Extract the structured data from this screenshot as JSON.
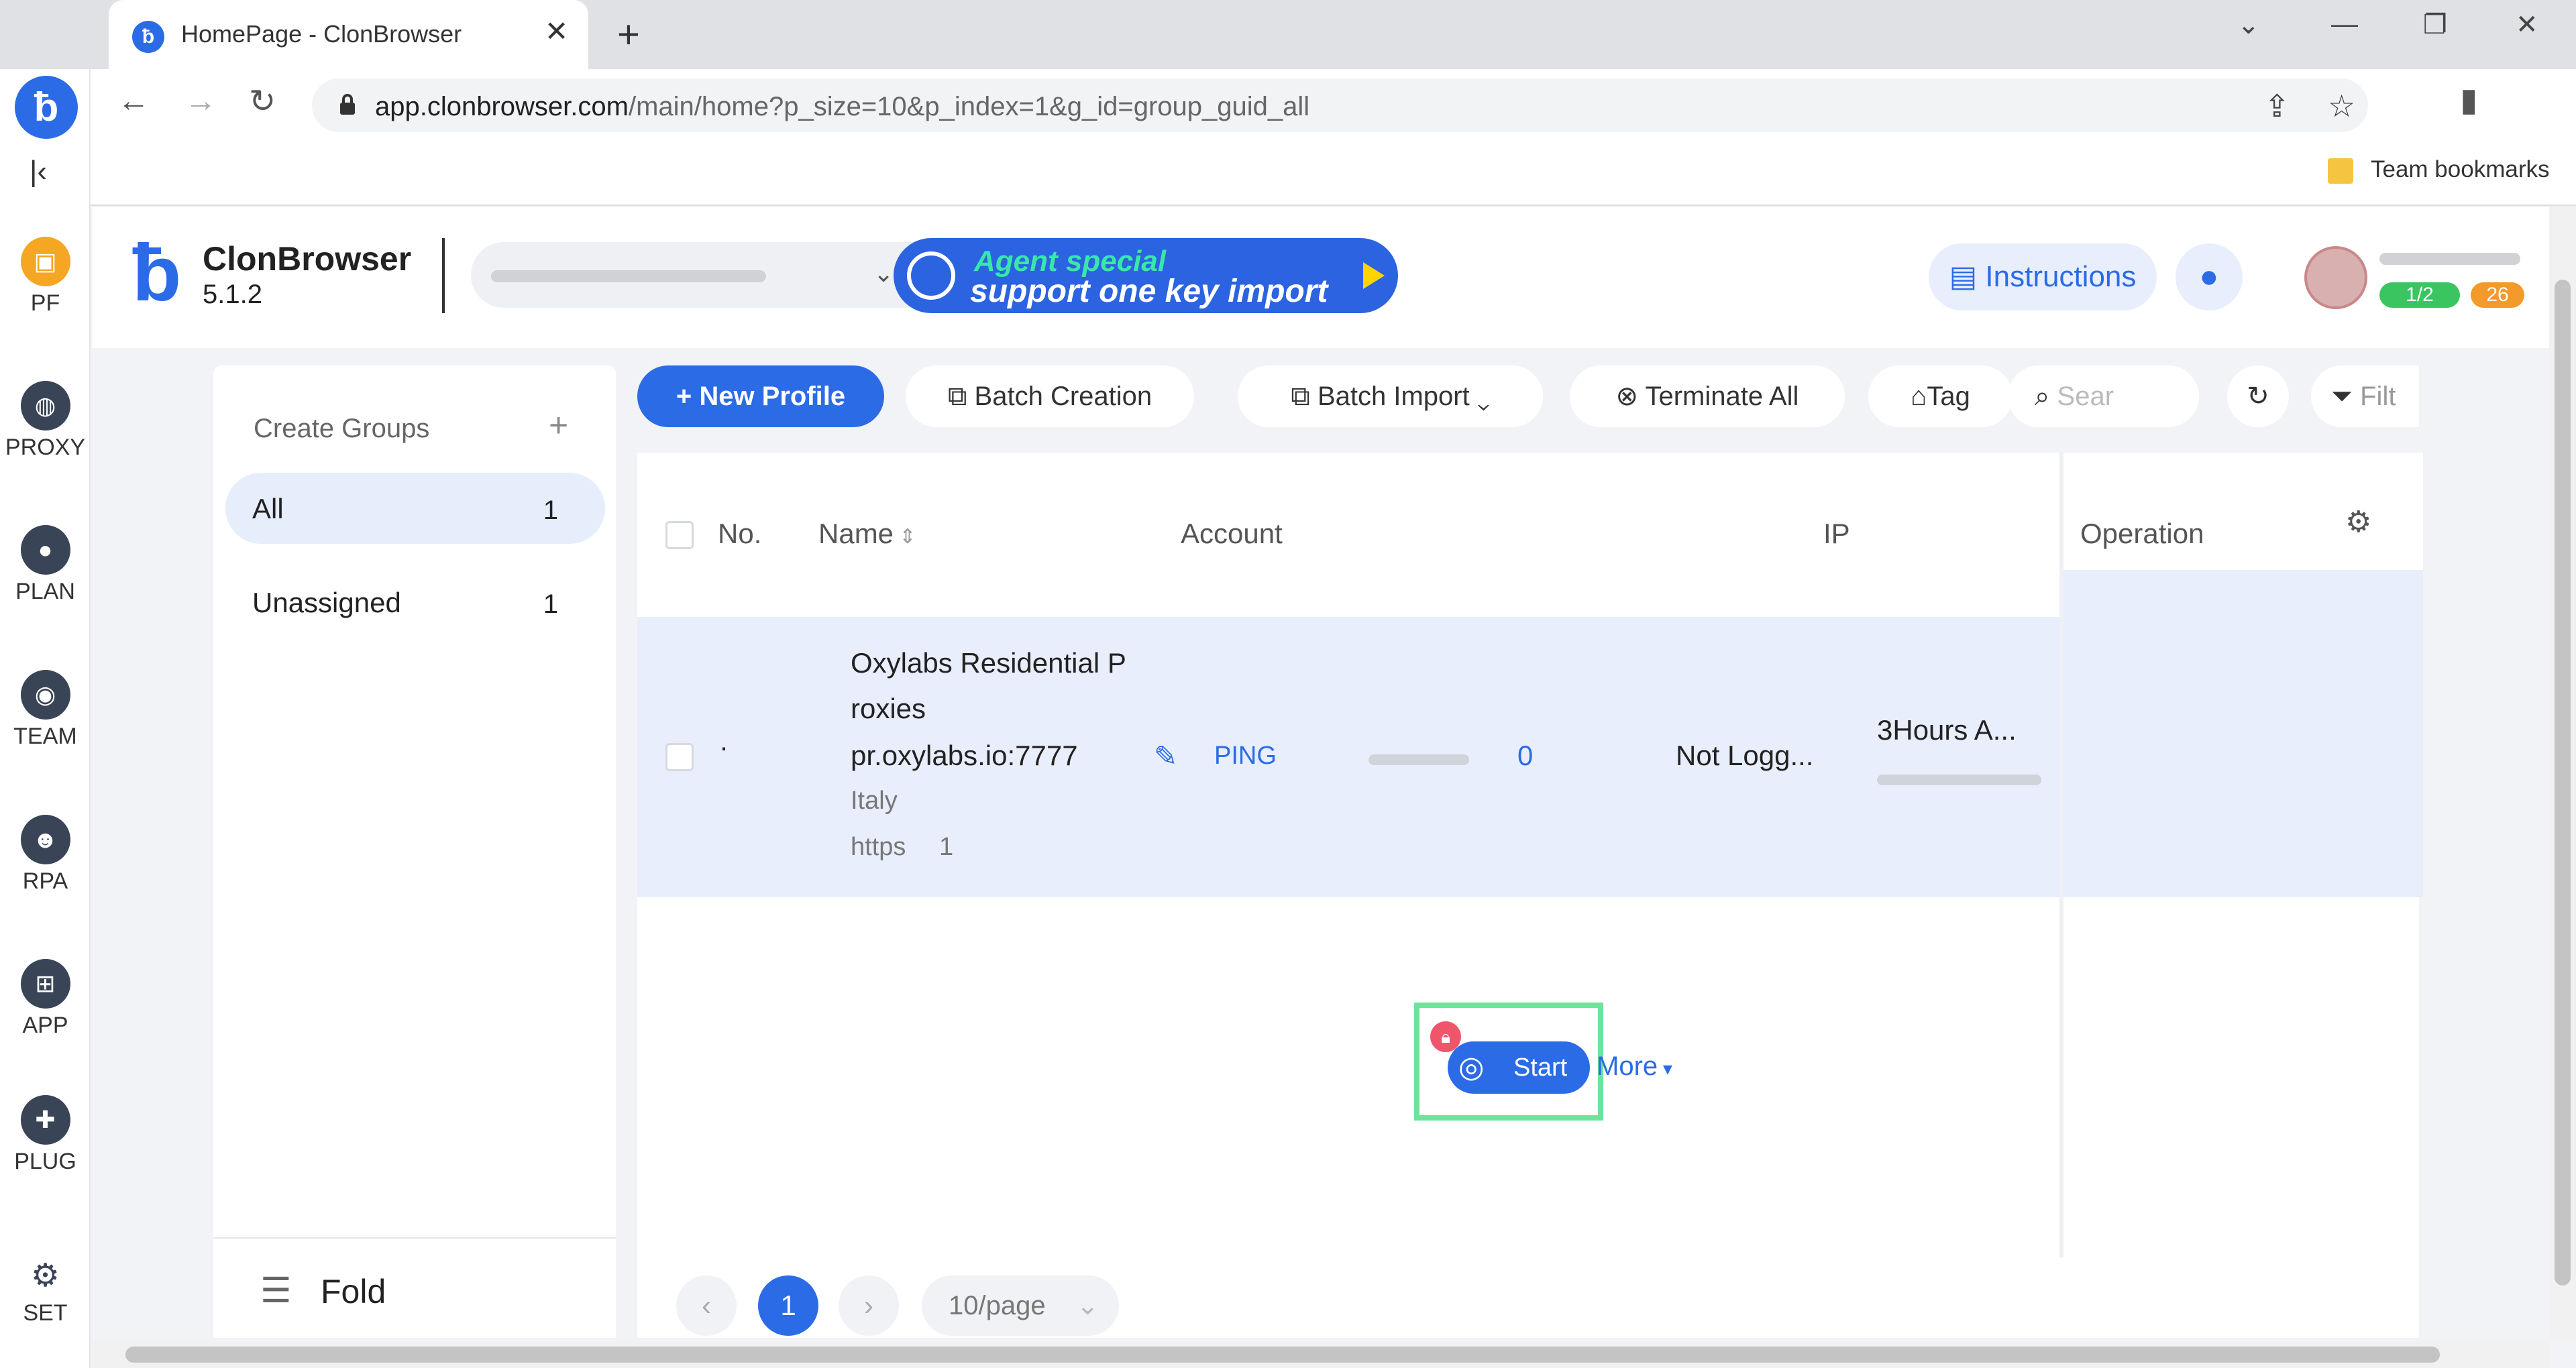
{
  "browser": {
    "tab_title": "HomePage - ClonBrowser",
    "new_tab": "+",
    "url_host": "app.clonbrowser.com",
    "url_path": "/main/home?p_size=10&p_index=1&g_id=group_guid_all",
    "bookmark": "Team bookmarks",
    "min": "—",
    "close": "✕"
  },
  "rail": {
    "items": [
      {
        "label": "PF",
        "icon": "profile-icon"
      },
      {
        "label": "PROXY",
        "icon": "globe-icon"
      },
      {
        "label": "PLAN",
        "icon": "user-icon"
      },
      {
        "label": "TEAM",
        "icon": "team-icon"
      },
      {
        "label": "RPA",
        "icon": "robot-icon"
      },
      {
        "label": "APP",
        "icon": "apps-icon"
      },
      {
        "label": "PLUG",
        "icon": "plugin-icon"
      },
      {
        "label": "SET",
        "icon": "gear-icon"
      }
    ]
  },
  "header": {
    "app_name": "ClonBrowser",
    "version": "5.1.2",
    "promo_line1": "Agent special",
    "promo_line2": "support one key import",
    "instructions": "Instructions",
    "badge_green": "1/2",
    "badge_orange": "26"
  },
  "groups": {
    "title": "Create Groups",
    "add": "+",
    "items": [
      {
        "name": "All",
        "count": "1"
      },
      {
        "name": "Unassigned",
        "count": "1"
      }
    ],
    "fold": "Fold"
  },
  "actions": {
    "new_profile": "New Profile",
    "batch_creation": "Batch Creation",
    "batch_import": "Batch Import",
    "terminate_all": "Terminate All",
    "tag": "Tag",
    "search_placeholder": "Sear",
    "filter": "Filt"
  },
  "table": {
    "headers": {
      "no": "No.",
      "name": "Name",
      "account": "Account",
      "ip": "IP",
      "operation": "Operation"
    },
    "row": {
      "no": "·",
      "name_line1": "Oxylabs Residential P",
      "name_line2": "roxies",
      "proxy": "pr.oxylabs.io:7777",
      "ping": "PING",
      "country": "Italy",
      "protocol": "https",
      "protocol_count": "1",
      "count": "0",
      "account": "Not Logg...",
      "ip_time": "3Hours A...",
      "start": "Start",
      "more": "More"
    }
  },
  "pager": {
    "current": "1",
    "page_size": "10/page"
  }
}
